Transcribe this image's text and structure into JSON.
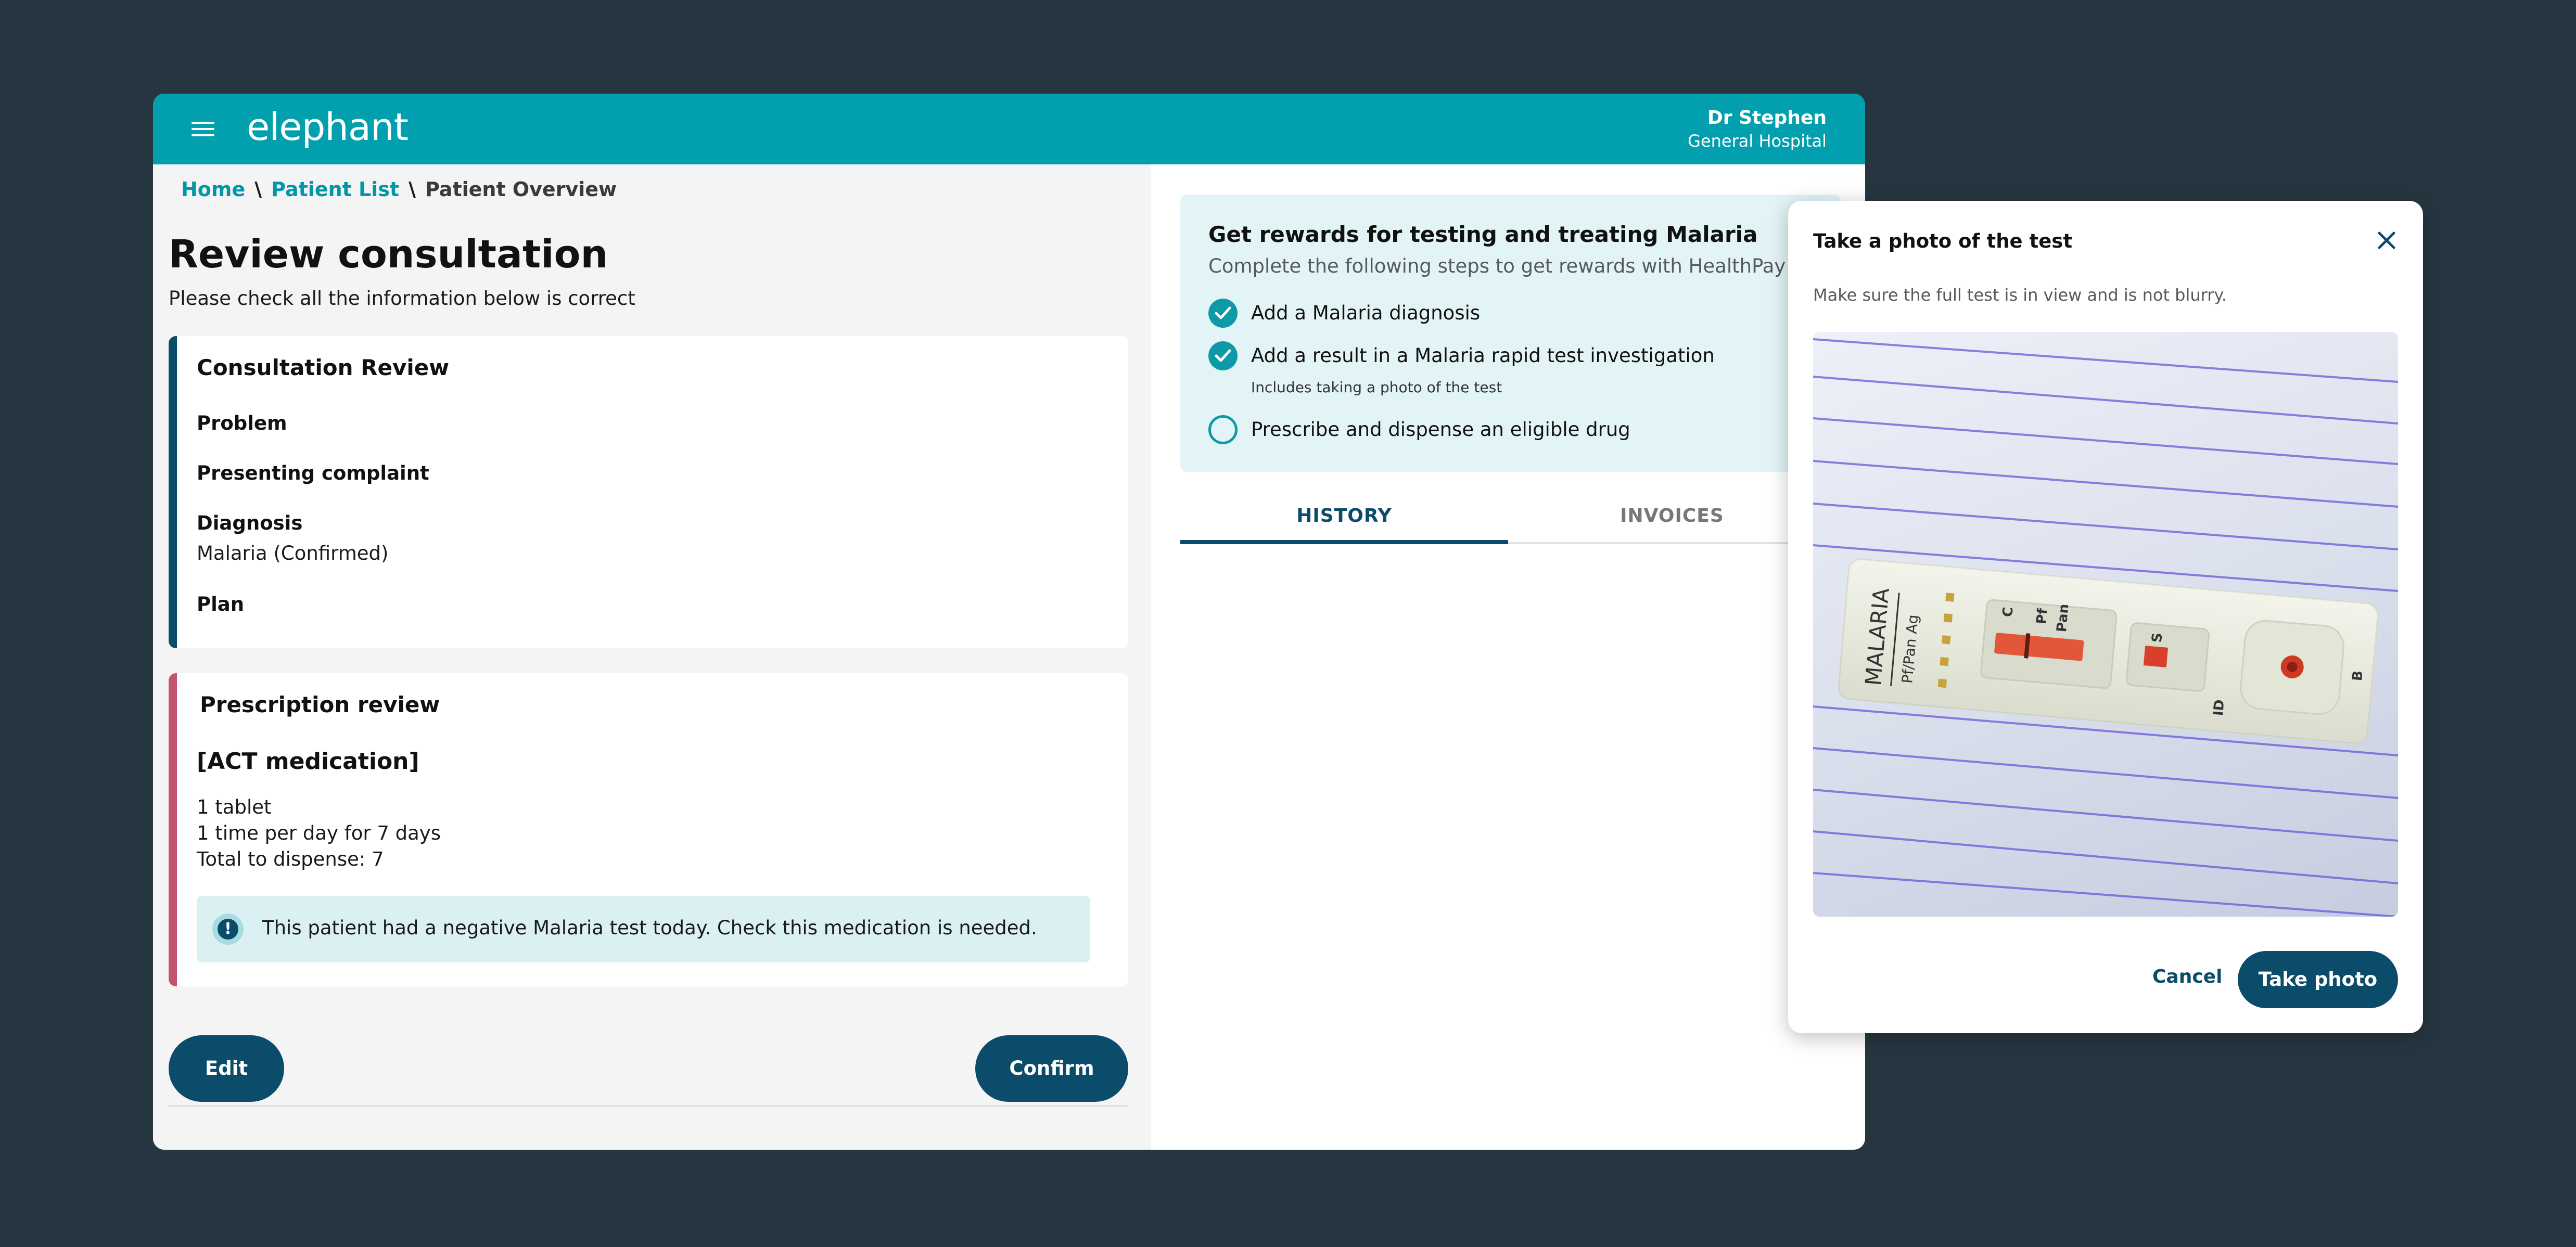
{
  "header": {
    "logo": "elephant",
    "user_name": "Dr Stephen",
    "user_hospital": "General Hospital"
  },
  "breadcrumb": {
    "home": "Home",
    "patient_list": "Patient List",
    "current": "Patient Overview",
    "separator": "\\"
  },
  "page": {
    "title": "Review consultation",
    "subtitle": "Please check all the information below is correct"
  },
  "consultation": {
    "title": "Consultation Review",
    "problem_label": "Problem",
    "complaint_label": "Presenting complaint",
    "diagnosis_label": "Diagnosis",
    "diagnosis_value": "Malaria (Confirmed)",
    "plan_label": "Plan"
  },
  "prescription": {
    "title": "Prescription review",
    "medication": "[ACT medication]",
    "dose": "1 tablet",
    "frequency": "1 time per day for 7 days",
    "total": "Total to dispense: 7",
    "alert_icon": "!",
    "alert_text": "This patient had a negative Malaria test today. Check this medication is needed."
  },
  "actions": {
    "edit": "Edit",
    "confirm": "Confirm"
  },
  "rewards": {
    "title": "Get rewards for testing and treating Malaria",
    "subtitle": "Complete the following steps to get rewards with HealthPay",
    "steps": [
      {
        "label": "Add a Malaria diagnosis",
        "done": true
      },
      {
        "label": "Add a result in a Malaria rapid test investigation",
        "note": "Includes taking a photo of the test",
        "done": true
      },
      {
        "label": "Prescribe and dispense an eligible drug",
        "done": false
      }
    ]
  },
  "tabs": [
    {
      "label": "HISTORY",
      "active": true
    },
    {
      "label": "INVOICES",
      "active": false
    }
  ],
  "modal": {
    "title": "Take a photo of the test",
    "description": "Make sure the full test is in view and is not blurry.",
    "cancel": "Cancel",
    "take_photo": "Take photo",
    "photo_text": {
      "brand": "MALARIA",
      "type": "Pf/Pan Ag",
      "c": "C",
      "pf": "Pf",
      "pan": "Pan",
      "s": "S",
      "id": "ID",
      "b": "B"
    }
  },
  "colors": {
    "header": "#02a0ae",
    "primary": "#0b4c6b",
    "consult_accent": "#0b4c6b",
    "rx_accent": "#c4546e",
    "background": "#263640"
  }
}
